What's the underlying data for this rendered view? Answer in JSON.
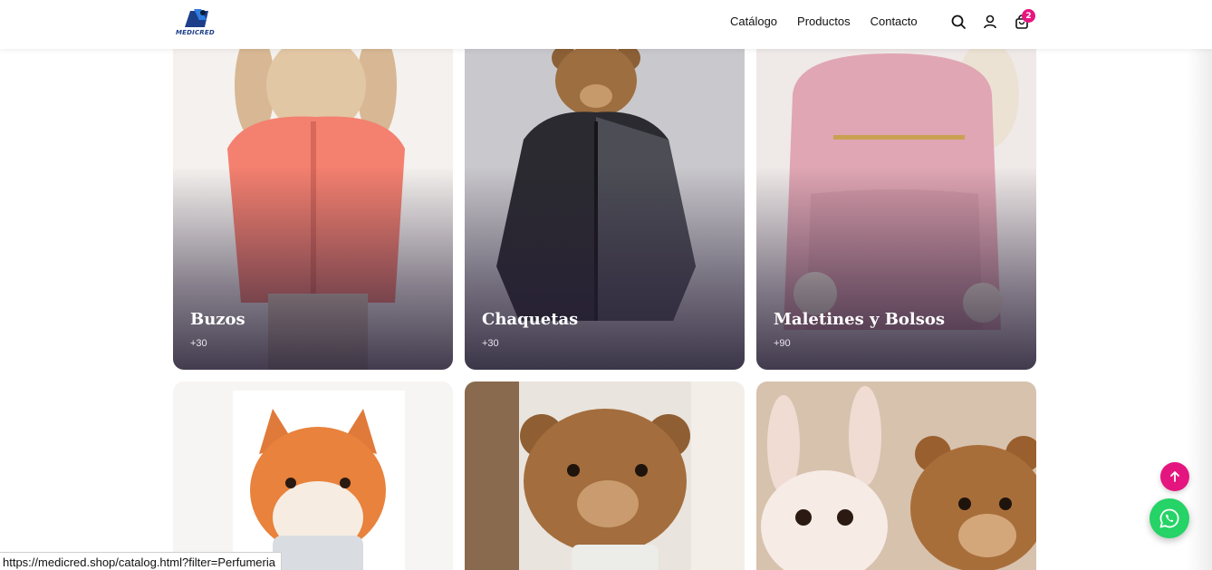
{
  "brand": {
    "logo_text": "MEDICRED"
  },
  "nav": {
    "items": [
      "Catálogo",
      "Productos",
      "Contacto"
    ]
  },
  "header_icons": {
    "search": "search-icon",
    "account": "user-icon",
    "cart": "shopping-bag-icon",
    "cart_count": "2"
  },
  "categories": [
    {
      "title": "Buzos",
      "count": "+30",
      "image": "bunny-in-coral-jacket"
    },
    {
      "title": "Chaquetas",
      "count": "+30",
      "image": "bear-in-black-jacket"
    },
    {
      "title": "Maletines y Bolsos",
      "count": "+90",
      "image": "pink-backpack-with-bunny"
    },
    {
      "title": "",
      "count": "",
      "image": "fox-plush-with-tumbler"
    },
    {
      "title": "",
      "count": "",
      "image": "teddy-bear-with-speaker"
    },
    {
      "title": "",
      "count": "",
      "image": "bunny-and-bear-plush"
    }
  ],
  "status_bar": {
    "url": "https://medicred.shop/catalog.html?filter=Perfumeria"
  },
  "floating": {
    "scroll_top_icon": "arrow-up-icon",
    "whatsapp_icon": "whatsapp-icon"
  },
  "colors": {
    "accent": "#e5157f",
    "whatsapp": "#25d366",
    "brand_blue": "#1d3f8a"
  }
}
